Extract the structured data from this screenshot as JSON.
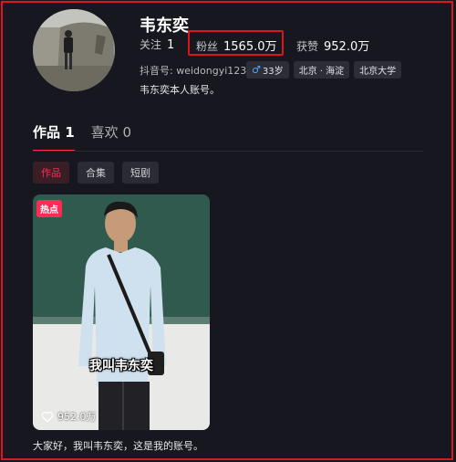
{
  "profile": {
    "nickname": "韦东奕",
    "following_label": "关注",
    "following_count": "1",
    "fans_label": "粉丝",
    "fans_count": "1565.0万",
    "likes_label": "获赞",
    "likes_count": "952.0万",
    "account_label": "抖音号: ",
    "account_id": "weidongyi123",
    "tags": {
      "age": "33岁",
      "location": "北京 · 海淀",
      "school": "北京大学"
    },
    "bio": "韦东奕本人账号。"
  },
  "tabs": [
    {
      "label": "作品 1",
      "active": true
    },
    {
      "label": "喜欢 0",
      "active": false
    }
  ],
  "subtabs": [
    {
      "label": "作品",
      "active": true
    },
    {
      "label": "合集",
      "active": false
    },
    {
      "label": "短剧",
      "active": false
    }
  ],
  "video": {
    "badge": "热点",
    "overlay_text": "我叫韦东奕",
    "likes": "952.0万",
    "caption": "大家好，我叫韦东奕，这是我的账号。"
  },
  "icons": {
    "likes": "heart-icon",
    "gender": "male-icon"
  },
  "colors": {
    "accent": "#fe2c55",
    "highlight_box": "#e0121a",
    "background": "#17171f"
  }
}
